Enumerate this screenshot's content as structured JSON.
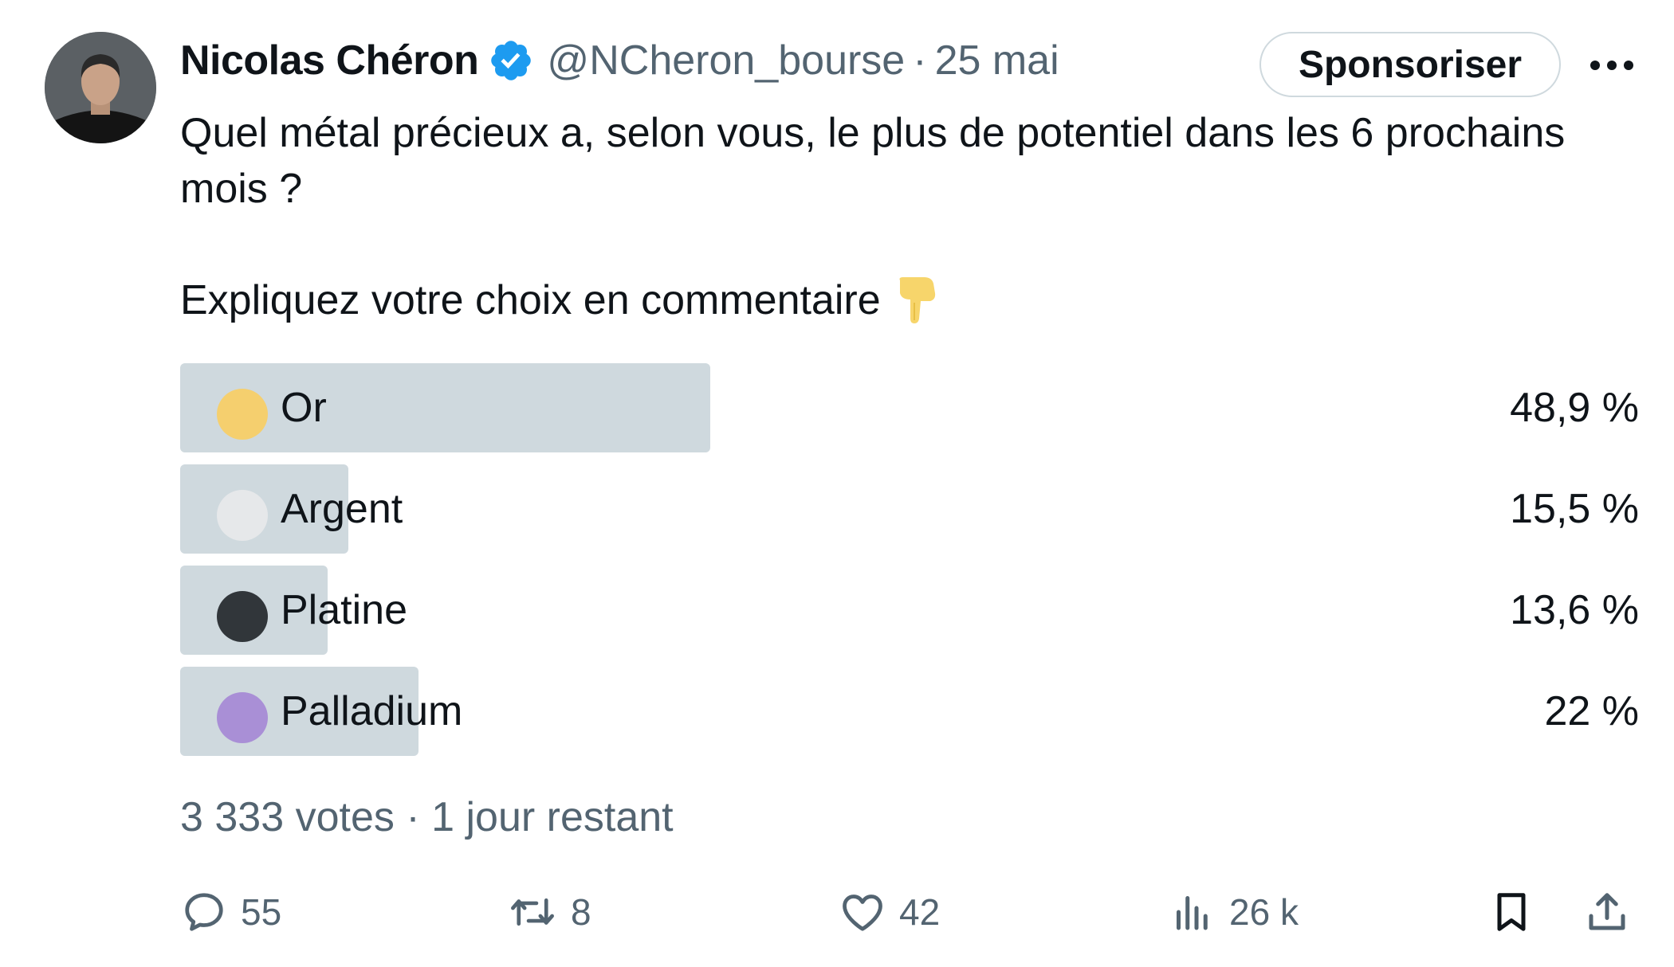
{
  "author": {
    "name": "Nicolas Chéron",
    "handle": "@NCheron_bourse",
    "separator": "·",
    "date": "25 mai"
  },
  "header": {
    "sponsor_label": "Sponsoriser",
    "more_icon": "more-horizontal-icon"
  },
  "tweet": {
    "text_line1": "Quel métal précieux a, selon vous, le plus de potentiel dans les 6 prochains mois ?",
    "text_line2": "Expliquez votre choix en commentaire"
  },
  "poll": {
    "options": [
      {
        "label": "Or",
        "percent_text": "48,9 %",
        "percent": 48.9,
        "dot_color": "#f5cf6e"
      },
      {
        "label": "Argent",
        "percent_text": "15,5 %",
        "percent": 15.5,
        "dot_color": "#e6e8ea"
      },
      {
        "label": "Platine",
        "percent_text": "13,6 %",
        "percent": 13.6,
        "dot_color": "#31363a"
      },
      {
        "label": "Palladium",
        "percent_text": "22 %",
        "percent": 22,
        "dot_color": "#a98fd6"
      }
    ],
    "votes": "3 333 votes",
    "separator": "·",
    "remaining": "1 jour restant",
    "bar_color": "#cfd9de"
  },
  "actions": {
    "replies": "55",
    "retweets": "8",
    "likes": "42",
    "views": "26 k"
  },
  "colors": {
    "text_primary": "#0f1419",
    "text_secondary": "#536471",
    "verified": "#1d9bf0"
  }
}
